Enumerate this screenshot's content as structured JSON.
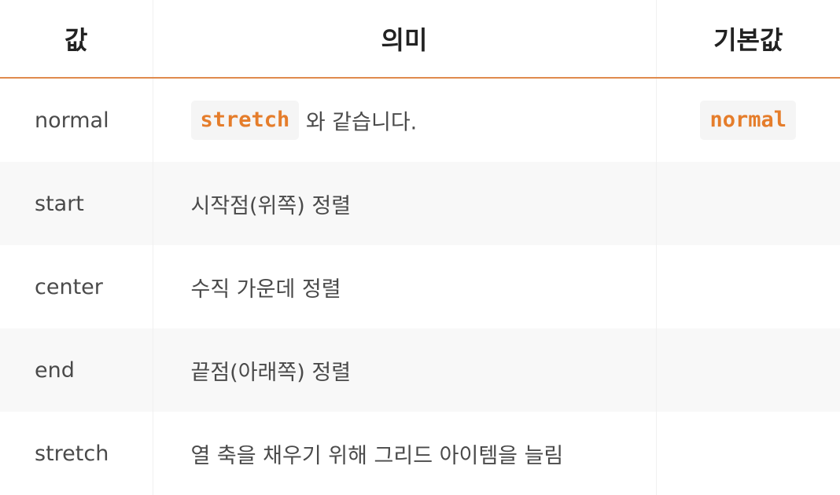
{
  "header": {
    "value": "값",
    "meaning": "의미",
    "default": "기본값"
  },
  "rows": [
    {
      "value": "normal",
      "meaning_code": "stretch",
      "meaning_text": " 와 같습니다.",
      "default_code": "normal"
    },
    {
      "value": "start",
      "meaning_text": "시작점(위쪽) 정렬"
    },
    {
      "value": "center",
      "meaning_text": "수직 가운데 정렬"
    },
    {
      "value": "end",
      "meaning_text": "끝점(아래쪽) 정렬"
    },
    {
      "value": "stretch",
      "meaning_text": "열 축을 채우기 위해 그리드 아이템을 늘림"
    }
  ],
  "colors": {
    "accent": "#e08a4d",
    "code_text": "#e57d2b",
    "code_bg": "#f5f5f5",
    "stripe": "#f8f8f8"
  }
}
